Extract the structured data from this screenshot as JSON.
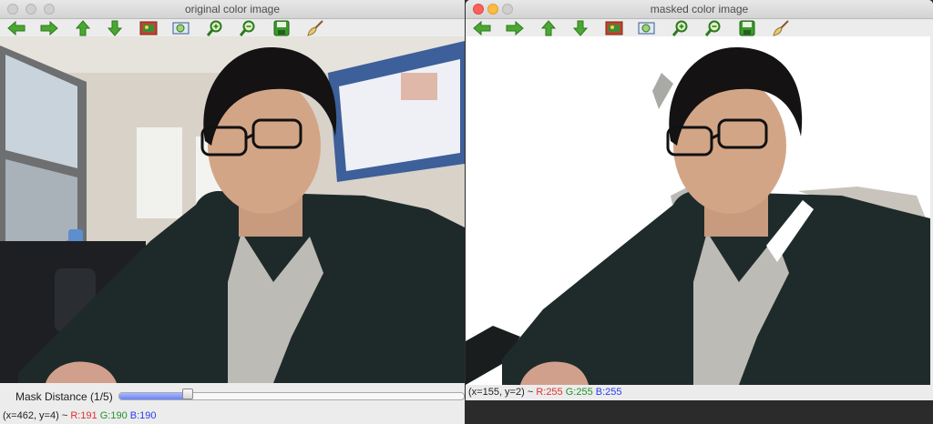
{
  "left_window": {
    "title": "original color image",
    "toolbar": [
      "arrow-left-icon",
      "arrow-right-icon",
      "arrow-up-icon",
      "arrow-down-icon",
      "image-icon",
      "zoom-fit-icon",
      "zoom-in-icon",
      "zoom-out-icon",
      "save-icon",
      "brush-icon"
    ],
    "trackbar": {
      "label": "Mask Distance (1/5)",
      "value_fraction": 0.2
    },
    "status": {
      "coords": "(x=462, y=4) ~",
      "r": "R:191",
      "g": "G:190",
      "b": "B:190"
    }
  },
  "right_window": {
    "title": "masked color image",
    "toolbar": [
      "arrow-left-icon",
      "arrow-right-icon",
      "arrow-up-icon",
      "arrow-down-icon",
      "image-icon",
      "zoom-fit-icon",
      "zoom-in-icon",
      "zoom-out-icon",
      "save-icon",
      "brush-icon"
    ],
    "status": {
      "coords": "(x=155, y=2) ~",
      "r": "R:255",
      "g": "G:255",
      "b": "B:255"
    }
  },
  "colors": {
    "status_red": "#e03030",
    "status_green": "#23922b",
    "status_blue": "#2a3cf0",
    "icon_green": "#4aa832"
  }
}
